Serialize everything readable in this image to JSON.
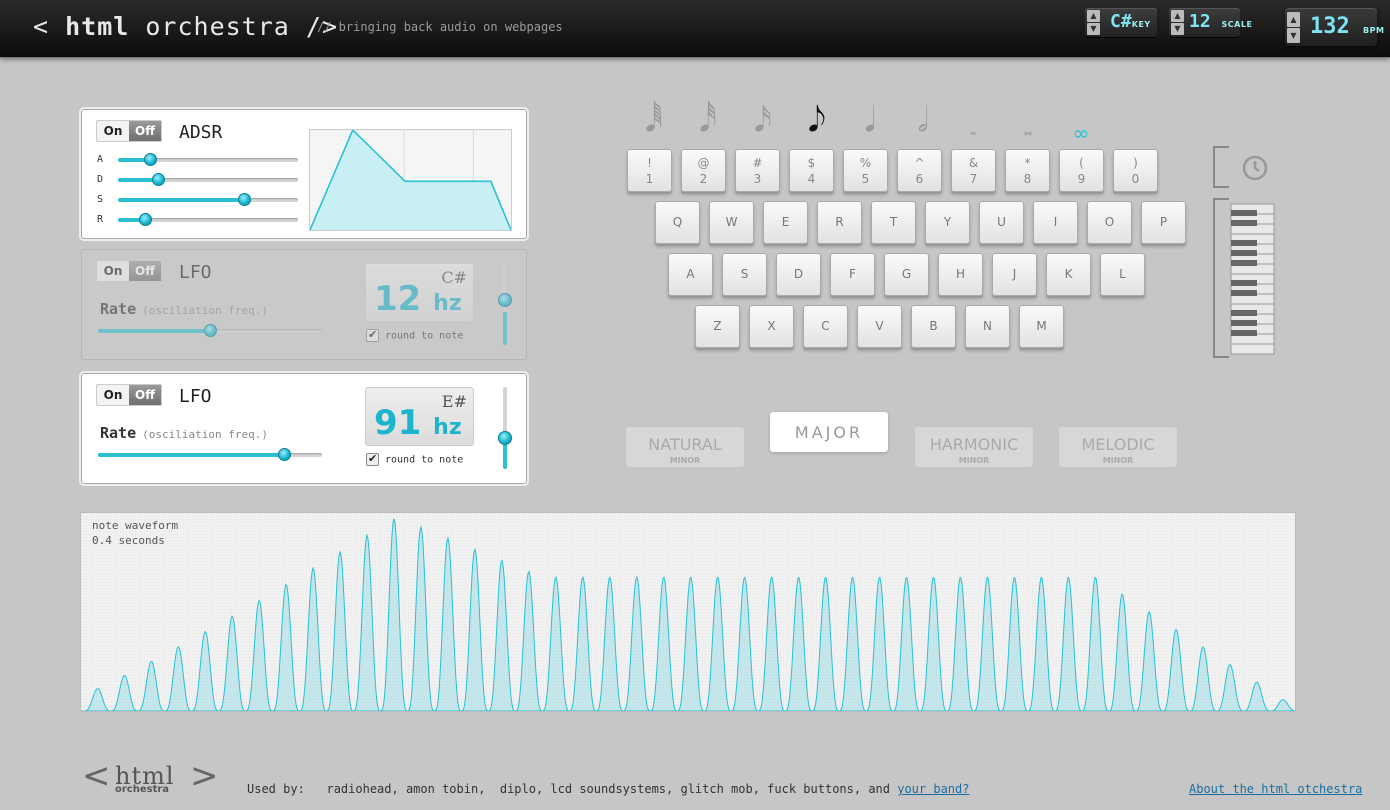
{
  "header": {
    "title_left": "< ",
    "title_bold": "html",
    "title_rest": " orchestra />",
    "tagline": "// bringing back audio on webpages",
    "key": {
      "value": "C#",
      "label": "KEY"
    },
    "scale": {
      "value": "12",
      "label": "SCALE"
    },
    "bpm": {
      "value": "132",
      "label": "BPM"
    },
    "arrow_up": "▲",
    "arrow_down": "▼"
  },
  "adsr": {
    "on_label": "On",
    "off_label": "Off",
    "title": "ADSR",
    "params": [
      {
        "label": "A",
        "value": 0.18
      },
      {
        "label": "D",
        "value": 0.22
      },
      {
        "label": "S",
        "value": 0.7
      },
      {
        "label": "R",
        "value": 0.15
      }
    ]
  },
  "lfo1": {
    "on_label": "On",
    "off_label": "Off",
    "title": "LFO",
    "rate_label": "Rate",
    "rate_hint": "(osciliation freq.)",
    "rate_value": 0.5,
    "hz_value": "12",
    "hz_unit": "hz",
    "note": "C#",
    "round_label": "round to note",
    "depth_value": 0.6,
    "enabled": false
  },
  "lfo2": {
    "on_label": "On",
    "off_label": "Off",
    "title": "LFO",
    "rate_label": "Rate",
    "rate_hint": "(osciliation freq.)",
    "rate_value": 0.83,
    "hz_value": "91",
    "hz_unit": "hz",
    "note": "E#",
    "round_label": "round to note",
    "depth_value": 0.62,
    "enabled": true
  },
  "note_durations": [
    {
      "name": "sixty-fourth-note-icon",
      "glyph": "𝅘𝅥𝅱"
    },
    {
      "name": "thirty-second-note-icon",
      "glyph": "𝅘𝅥𝅰"
    },
    {
      "name": "sixteenth-note-icon",
      "glyph": "𝅘𝅥𝅯"
    },
    {
      "name": "eighth-note-icon",
      "glyph": "𝅘𝅥𝅮",
      "selected": true
    },
    {
      "name": "quarter-note-icon",
      "glyph": "𝅘𝅥"
    },
    {
      "name": "half-note-icon",
      "glyph": "𝅗𝅥"
    },
    {
      "name": "whole-note-icon",
      "glyph": "𝅝"
    },
    {
      "name": "double-whole-note-icon",
      "glyph": "𝅜"
    },
    {
      "name": "infinite-note-icon",
      "glyph": "∞"
    }
  ],
  "keyboard": {
    "number_row": [
      {
        "top": "!",
        "bottom": "1"
      },
      {
        "top": "@",
        "bottom": "2"
      },
      {
        "top": "#",
        "bottom": "3"
      },
      {
        "top": "$",
        "bottom": "4"
      },
      {
        "top": "%",
        "bottom": "5"
      },
      {
        "top": "^",
        "bottom": "6"
      },
      {
        "top": "&",
        "bottom": "7"
      },
      {
        "top": "*",
        "bottom": "8"
      },
      {
        "top": "(",
        "bottom": "9"
      },
      {
        "top": ")",
        "bottom": "0"
      }
    ],
    "row1": [
      "Q",
      "W",
      "E",
      "R",
      "T",
      "Y",
      "U",
      "I",
      "O",
      "P"
    ],
    "row2": [
      "A",
      "S",
      "D",
      "F",
      "G",
      "H",
      "J",
      "K",
      "L"
    ],
    "row3": [
      "Z",
      "X",
      "C",
      "V",
      "B",
      "N",
      "M"
    ]
  },
  "scales": [
    {
      "name": "NATURAL",
      "sub": "MINOR"
    },
    {
      "name": "MAJOR",
      "sub": "",
      "selected": true
    },
    {
      "name": "HARMONIC",
      "sub": "MINOR"
    },
    {
      "name": "MELODIC",
      "sub": "MINOR"
    }
  ],
  "waveform": {
    "caption1": "note waveform",
    "caption2": "0.4 seconds",
    "color": "#27c1d4"
  },
  "footer": {
    "logo_html": "html",
    "logo_orchestra": "orchestra",
    "used_by_prefix": "Used by:   radiohead, amon tobin,  diplo, lcd soundsystems, glitch mob, fuck buttons, and ",
    "used_by_link": "your band?",
    "about_link": "About the html otchestra"
  },
  "colors": {
    "accent": "#27c1d4",
    "header_bg": "#111111",
    "page_bg": "#c6c6c6"
  }
}
